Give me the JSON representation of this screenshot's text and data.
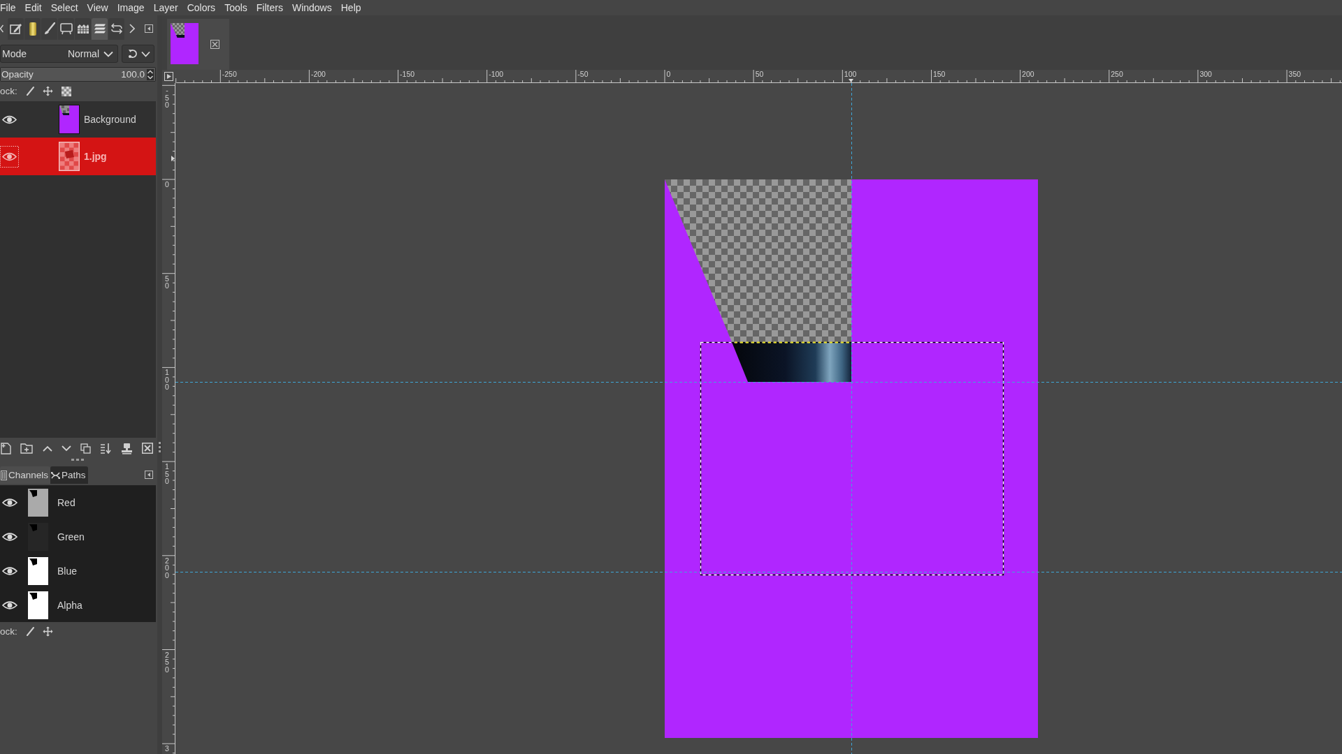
{
  "menu_bar": [
    "File",
    "Edit",
    "Select",
    "View",
    "Image",
    "Layer",
    "Colors",
    "Tools",
    "Filters",
    "Windows",
    "Help"
  ],
  "dock_tabs": [
    {
      "selected": false
    },
    {
      "selected": false
    },
    {
      "selected": false
    },
    {
      "selected": false
    },
    {
      "selected": false
    },
    {
      "selected": true
    },
    {
      "selected": false
    }
  ],
  "layers_panel": {
    "mode": {
      "label": "Mode",
      "value": "Normal"
    },
    "opacity": {
      "label": "Opacity",
      "value": "100.0",
      "level": 1
    },
    "lock_label": "ock:",
    "layers": [
      {
        "name": "Background",
        "visible": true,
        "selected": false
      },
      {
        "name": "1.jpg",
        "visible": true,
        "selected": true
      }
    ]
  },
  "channels_panel": {
    "tabs": [
      {
        "label": "Channels",
        "selected": true
      },
      {
        "label": "Paths",
        "selected": false
      }
    ],
    "channels": [
      {
        "name": "Red",
        "visible": true,
        "color": "#aaaaaa"
      },
      {
        "name": "Green",
        "visible": true,
        "color": "#262626"
      },
      {
        "name": "Blue",
        "visible": true,
        "color": "#ffffff"
      },
      {
        "name": "Alpha",
        "visible": true,
        "color": "#ffffff"
      }
    ],
    "lock_label": "ock:"
  },
  "horizontal_ruler": {
    "labels": [
      "-250",
      "-200",
      "-150",
      "-100",
      "-50",
      "0",
      "50",
      "100",
      "150",
      "200",
      "250",
      "300",
      "350"
    ]
  },
  "vertical_ruler": {
    "labels": [
      "-50",
      "0",
      "50",
      "100",
      "150",
      "200",
      "250",
      "3"
    ]
  }
}
